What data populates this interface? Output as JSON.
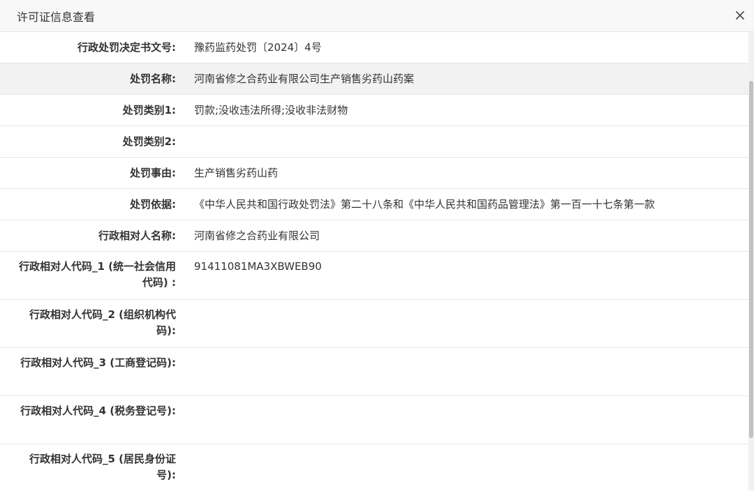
{
  "dialog": {
    "title": "许可证信息查看",
    "close_label": "×"
  },
  "fields": [
    {
      "label": "行政处罚决定书文号:",
      "value": "豫药监药处罚〔2024〕4号"
    },
    {
      "label": "处罚名称:",
      "value": "河南省修之合药业有限公司生产销售劣药山药案"
    },
    {
      "label": "处罚类别1:",
      "value": "罚款;没收违法所得;没收非法财物"
    },
    {
      "label": "处罚类别2:",
      "value": ""
    },
    {
      "label": "处罚事由:",
      "value": "生产销售劣药山药"
    },
    {
      "label": "处罚依据:",
      "value": "《中华人民共和国行政处罚法》第二十八条和《中华人民共和国药品管理法》第一百一十七条第一款"
    },
    {
      "label": "行政相对人名称:",
      "value": "河南省修之合药业有限公司"
    },
    {
      "label": "行政相对人代码_1 (统一社会信用代码) :",
      "value": "91411081MA3XBWEB90"
    },
    {
      "label": "行政相对人代码_2 (组织机构代码):",
      "value": ""
    },
    {
      "label": "行政相对人代码_3 (工商登记码):",
      "value": ""
    },
    {
      "label": "行政相对人代码_4 (税务登记号):",
      "value": ""
    },
    {
      "label": "行政相对人代码_5 (居民身份证号):",
      "value": ""
    }
  ]
}
